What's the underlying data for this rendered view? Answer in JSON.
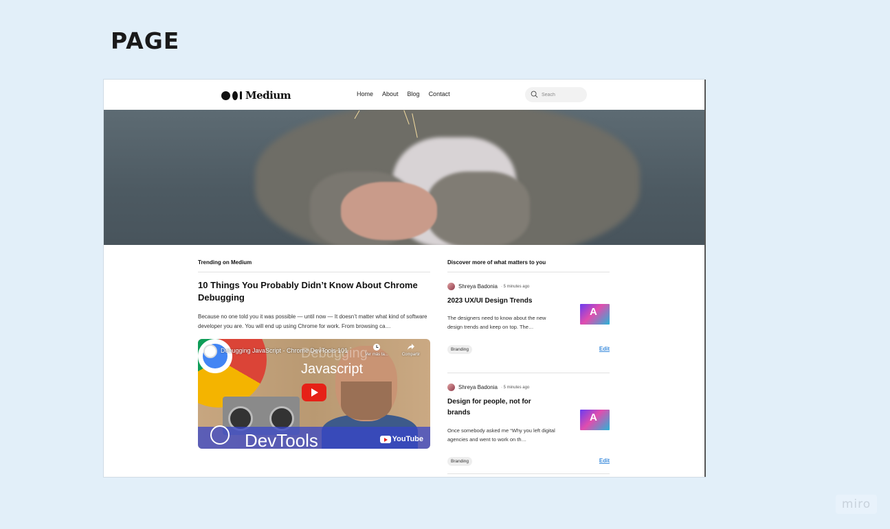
{
  "board": {
    "title": "PAGE"
  },
  "nav": {
    "logo_text": "Medium",
    "links": [
      "Home",
      "About",
      "Blog",
      "Contact"
    ],
    "search_placeholder": "Seach"
  },
  "trending": {
    "section_title": "Trending on Medium",
    "article_title": "10 Things You Probably Didn’t Know About Chrome Debugging",
    "excerpt": "Because no one told you it was possible — until now — It doesn’t matter what kind of software developer you are. You will end up using Chrome for work. From browsing ca…",
    "video": {
      "title": "Debugging JavaScript - Chrome DevTools 101",
      "overlay_line1": "Debugging",
      "overlay_line2": "Javascript",
      "watch_later": "Ver más ta...",
      "share": "Compartir",
      "brand_text": "DevTools",
      "platform": "YouTube"
    }
  },
  "discover": {
    "section_title": "Discover more of what matters to you",
    "articles": [
      {
        "author": "Shreya Badonia",
        "time": "5 minutes ago",
        "title": "2023 UX/UI Design Trends",
        "excerpt": "The designers need to know about the new design trends and keep on top. The…",
        "tag": "Branding",
        "edit": "Edit",
        "thumb_letter": "A"
      },
      {
        "author": "Shreya Badonia",
        "time": "5 minutes ago",
        "title": "Design for people, not for brands",
        "excerpt": "Once somebody asked me “Why you left digital agencies and went to work on th…",
        "tag": "Branding",
        "edit": "Edit",
        "thumb_letter": "A"
      }
    ]
  },
  "watermark": "miro",
  "colors": {
    "canvas": "#e2eff9",
    "link_blue": "#3a8bdc",
    "youtube_red": "#e62117"
  }
}
